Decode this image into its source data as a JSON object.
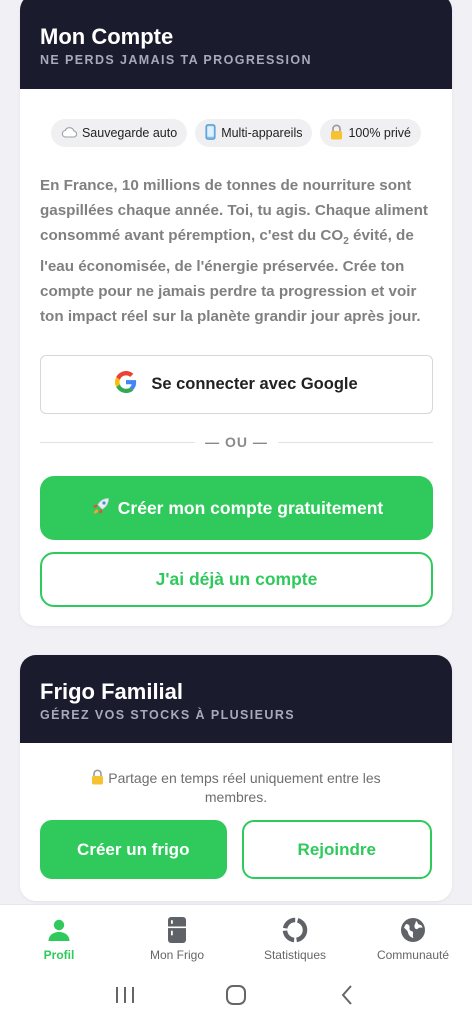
{
  "account": {
    "title": "Mon Compte",
    "subtitle": "NE PERDS JAMAIS TA PROGRESSION",
    "badges": [
      {
        "icon": "cloud-icon",
        "label": "Sauvegarde auto"
      },
      {
        "icon": "phone-icon",
        "label": "Multi-appareils"
      },
      {
        "icon": "lock-icon",
        "label": "100% privé"
      }
    ],
    "description_before": "En France, 10 millions de tonnes de nourriture sont gaspillées chaque année. Toi, tu agis. Chaque aliment consommé avant péremption, c'est du CO",
    "description_sub": "2",
    "description_after": " évité, de l'eau économisée, de l'énergie préservée. Crée ton compte pour ne jamais perdre ta progression et voir ton impact réel sur la planète grandir jour après jour.",
    "google_label": "Se connecter avec Google",
    "divider_label": "— OU —",
    "create_label": "Créer mon compte gratuitement",
    "create_icon": "rocket-icon",
    "login_label": "J'ai déjà un compte"
  },
  "fridge": {
    "title": "Frigo Familial",
    "subtitle": "GÉREZ VOS STOCKS À PLUSIEURS",
    "note": "Partage en temps réel uniquement entre les membres.",
    "note_icon": "lock-icon",
    "create_label": "Créer un frigo",
    "join_label": "Rejoindre"
  },
  "nav": {
    "items": [
      {
        "label": "Profil",
        "icon": "person-icon",
        "active": true
      },
      {
        "label": "Mon Frigo",
        "icon": "fridge-icon",
        "active": false
      },
      {
        "label": "Statistiques",
        "icon": "chart-ring-icon",
        "active": false
      },
      {
        "label": "Communauté",
        "icon": "globe-icon",
        "active": false
      }
    ]
  },
  "colors": {
    "accent": "#2fc95c",
    "header_bg": "#1b1b2e",
    "page_bg": "#f1f1f5"
  }
}
